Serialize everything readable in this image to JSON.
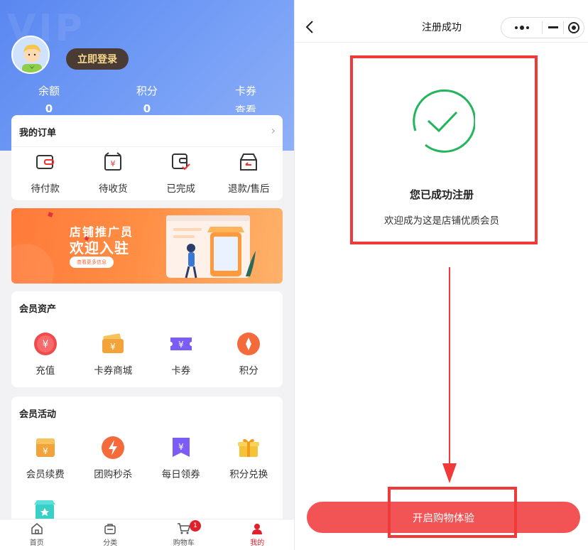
{
  "left": {
    "login_label": "立即登录",
    "stats": [
      {
        "label": "余额",
        "value": "0"
      },
      {
        "label": "积分",
        "value": "0"
      },
      {
        "label": "卡券",
        "value": "查看"
      }
    ],
    "orders": {
      "title": "我的订单",
      "items": [
        {
          "label": "待付款",
          "icon": "wallet-icon"
        },
        {
          "label": "待收货",
          "icon": "yuan-box-icon"
        },
        {
          "label": "已完成",
          "icon": "wallet-check-icon"
        },
        {
          "label": "退款/售后",
          "icon": "refund-box-icon"
        }
      ]
    },
    "banner": {
      "line1": "店铺推广员",
      "line2": "欢迎入驻",
      "button": "查看更多信息"
    },
    "assets": {
      "title": "会员资产",
      "items": [
        {
          "label": "充值",
          "icon": "recharge-icon",
          "color": "#f24a4a"
        },
        {
          "label": "卡券商城",
          "icon": "coupon-mall-icon",
          "color": "#f2a43a"
        },
        {
          "label": "卡券",
          "icon": "coupon-icon",
          "color": "#7b5cf5"
        },
        {
          "label": "积分",
          "icon": "points-icon",
          "color": "#f56a3a"
        }
      ]
    },
    "activities": {
      "title": "会员活动",
      "items": [
        {
          "label": "会员续费",
          "icon": "renew-icon",
          "color": "#f2a43a"
        },
        {
          "label": "团购秒杀",
          "icon": "flash-sale-icon",
          "color": "#f56a3a"
        },
        {
          "label": "每日领券",
          "icon": "daily-coupon-icon",
          "color": "#7b5cf5"
        },
        {
          "label": "积分兑换",
          "icon": "gift-icon",
          "color": "#f5c23a"
        }
      ]
    },
    "tabbar": [
      {
        "label": "首页",
        "icon": "home-icon"
      },
      {
        "label": "分类",
        "icon": "category-icon"
      },
      {
        "label": "购物车",
        "icon": "cart-icon",
        "badge": "1"
      },
      {
        "label": "我的",
        "icon": "user-icon",
        "active": true
      }
    ]
  },
  "right": {
    "nav_title": "注册成功",
    "success_title": "您已成功注册",
    "success_sub": "欢迎成为这是店铺优质会员",
    "cta_label": "开启购物体验"
  },
  "colors": {
    "brand_red": "#f25355",
    "annotation_red": "#f03a3a",
    "success_green": "#22b55c",
    "hero_blue": "#6f9af5"
  }
}
